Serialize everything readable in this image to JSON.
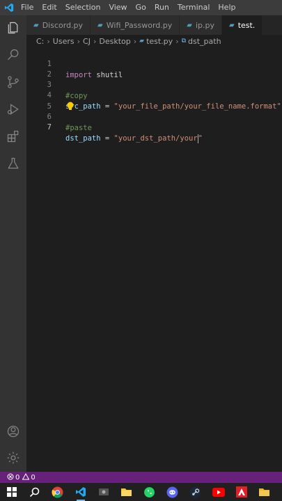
{
  "menu": [
    "File",
    "Edit",
    "Selection",
    "View",
    "Go",
    "Run",
    "Terminal",
    "Help"
  ],
  "tabs": [
    {
      "label": "Discord.py",
      "active": false
    },
    {
      "label": "Wifi_Password.py",
      "active": false
    },
    {
      "label": "ip.py",
      "active": false
    },
    {
      "label": "test.",
      "active": true
    }
  ],
  "breadcrumb": [
    "C:",
    "Users",
    "CJ",
    "Desktop",
    "test.py",
    "dst_path"
  ],
  "editor": {
    "line_numbers": [
      "1",
      "2",
      "3",
      "4",
      "5",
      "6",
      "7"
    ],
    "line1": {
      "kw": "import",
      "rest": " shutil"
    },
    "line3": {
      "comment": "#copy"
    },
    "line4": {
      "var": "src_path",
      "op": " = ",
      "str": "\"your_file_path/your_file_name.format\""
    },
    "line6": {
      "comment": "#paste"
    },
    "line7": {
      "var": "dst_path",
      "op": " = ",
      "str_open": "\"your_dst_path/your",
      "str_close": "\""
    }
  },
  "status": {
    "errors": "0",
    "warnings": "0"
  },
  "colors": {
    "status_bar": "#68217a",
    "editor_bg": "#1e1e1e",
    "activity_bar": "#333333"
  }
}
